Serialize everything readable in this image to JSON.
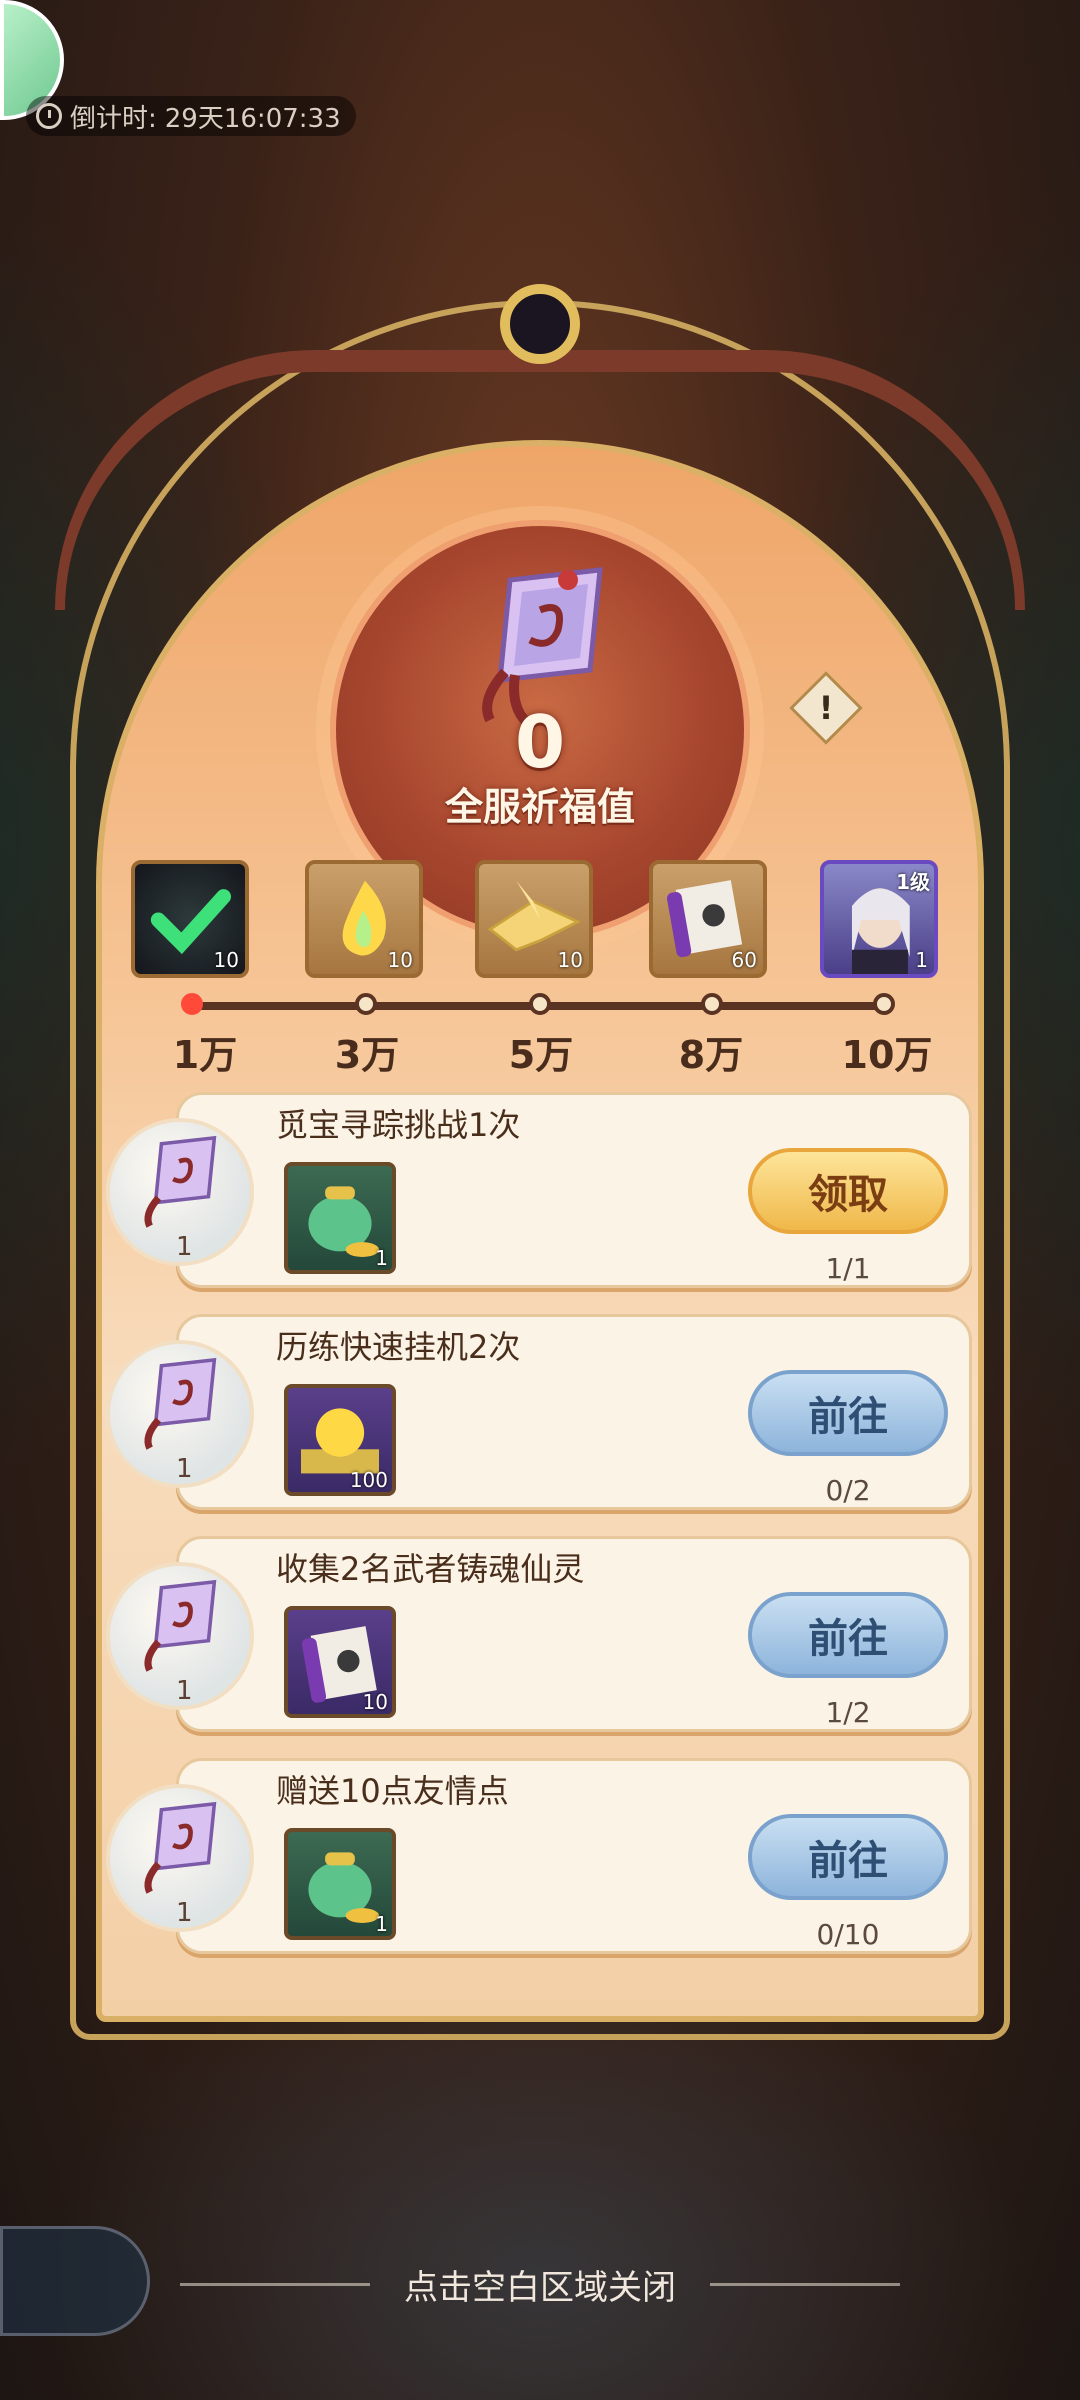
{
  "countdown": {
    "label": "倒计时:",
    "value": "29天16:07:33"
  },
  "blessing": {
    "value": "0",
    "label": "全服祈福值"
  },
  "milestones": [
    {
      "reward": "green-check-item",
      "qty": "10",
      "threshold": "1万",
      "reached": true
    },
    {
      "reward": "golden-flame-item",
      "qty": "10",
      "threshold": "3万",
      "reached": false
    },
    {
      "reward": "paper-crane-item",
      "qty": "10",
      "threshold": "5万",
      "reached": false
    },
    {
      "reward": "purple-scroll-item",
      "qty": "60",
      "threshold": "8万",
      "reached": false
    },
    {
      "reward": "character-portrait",
      "qty": "1",
      "level": "1级",
      "threshold": "10万",
      "reached": false
    }
  ],
  "tasks": [
    {
      "title": "觅宝寻踪挑战1次",
      "badge_qty": "1",
      "reward_qty": "1",
      "reward_icon": "green-money-bag-icon",
      "button": "领取",
      "button_type": "claim",
      "progress": "1/1"
    },
    {
      "title": "历练快速挂机2次",
      "badge_qty": "1",
      "reward_qty": "100",
      "reward_icon": "golden-orb-box-icon",
      "button": "前往",
      "button_type": "go",
      "progress": "0/2"
    },
    {
      "title": "收集2名武者铸魂仙灵",
      "badge_qty": "1",
      "reward_qty": "10",
      "reward_icon": "purple-scroll-icon",
      "button": "前往",
      "button_type": "go",
      "progress": "1/2"
    },
    {
      "title": "赠送10点友情点",
      "badge_qty": "1",
      "reward_qty": "1",
      "reward_icon": "green-money-bag-icon",
      "button": "前往",
      "button_type": "go",
      "progress": "0/10"
    }
  ],
  "close_hint": "点击空白区域关闭",
  "colors": {
    "accent_gold": "#c7a25a",
    "claim_button": "#f0b84a",
    "go_button": "#8db4db",
    "active_dot": "#ff4a3a"
  }
}
